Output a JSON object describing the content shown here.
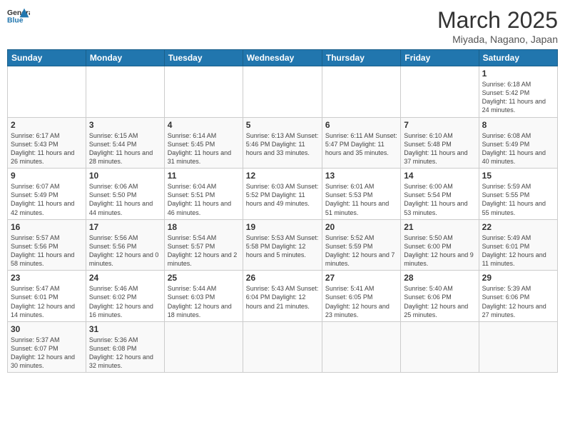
{
  "logo": {
    "line1": "General",
    "line2": "Blue"
  },
  "title": "March 2025",
  "subtitle": "Miyada, Nagano, Japan",
  "days_of_week": [
    "Sunday",
    "Monday",
    "Tuesday",
    "Wednesday",
    "Thursday",
    "Friday",
    "Saturday"
  ],
  "weeks": [
    [
      {
        "day": "",
        "info": ""
      },
      {
        "day": "",
        "info": ""
      },
      {
        "day": "",
        "info": ""
      },
      {
        "day": "",
        "info": ""
      },
      {
        "day": "",
        "info": ""
      },
      {
        "day": "",
        "info": ""
      },
      {
        "day": "1",
        "info": "Sunrise: 6:18 AM\nSunset: 5:42 PM\nDaylight: 11 hours and 24 minutes."
      }
    ],
    [
      {
        "day": "2",
        "info": "Sunrise: 6:17 AM\nSunset: 5:43 PM\nDaylight: 11 hours and 26 minutes."
      },
      {
        "day": "3",
        "info": "Sunrise: 6:15 AM\nSunset: 5:44 PM\nDaylight: 11 hours and 28 minutes."
      },
      {
        "day": "4",
        "info": "Sunrise: 6:14 AM\nSunset: 5:45 PM\nDaylight: 11 hours and 31 minutes."
      },
      {
        "day": "5",
        "info": "Sunrise: 6:13 AM\nSunset: 5:46 PM\nDaylight: 11 hours and 33 minutes."
      },
      {
        "day": "6",
        "info": "Sunrise: 6:11 AM\nSunset: 5:47 PM\nDaylight: 11 hours and 35 minutes."
      },
      {
        "day": "7",
        "info": "Sunrise: 6:10 AM\nSunset: 5:48 PM\nDaylight: 11 hours and 37 minutes."
      },
      {
        "day": "8",
        "info": "Sunrise: 6:08 AM\nSunset: 5:49 PM\nDaylight: 11 hours and 40 minutes."
      }
    ],
    [
      {
        "day": "9",
        "info": "Sunrise: 6:07 AM\nSunset: 5:49 PM\nDaylight: 11 hours and 42 minutes."
      },
      {
        "day": "10",
        "info": "Sunrise: 6:06 AM\nSunset: 5:50 PM\nDaylight: 11 hours and 44 minutes."
      },
      {
        "day": "11",
        "info": "Sunrise: 6:04 AM\nSunset: 5:51 PM\nDaylight: 11 hours and 46 minutes."
      },
      {
        "day": "12",
        "info": "Sunrise: 6:03 AM\nSunset: 5:52 PM\nDaylight: 11 hours and 49 minutes."
      },
      {
        "day": "13",
        "info": "Sunrise: 6:01 AM\nSunset: 5:53 PM\nDaylight: 11 hours and 51 minutes."
      },
      {
        "day": "14",
        "info": "Sunrise: 6:00 AM\nSunset: 5:54 PM\nDaylight: 11 hours and 53 minutes."
      },
      {
        "day": "15",
        "info": "Sunrise: 5:59 AM\nSunset: 5:55 PM\nDaylight: 11 hours and 55 minutes."
      }
    ],
    [
      {
        "day": "16",
        "info": "Sunrise: 5:57 AM\nSunset: 5:56 PM\nDaylight: 11 hours and 58 minutes."
      },
      {
        "day": "17",
        "info": "Sunrise: 5:56 AM\nSunset: 5:56 PM\nDaylight: 12 hours and 0 minutes."
      },
      {
        "day": "18",
        "info": "Sunrise: 5:54 AM\nSunset: 5:57 PM\nDaylight: 12 hours and 2 minutes."
      },
      {
        "day": "19",
        "info": "Sunrise: 5:53 AM\nSunset: 5:58 PM\nDaylight: 12 hours and 5 minutes."
      },
      {
        "day": "20",
        "info": "Sunrise: 5:52 AM\nSunset: 5:59 PM\nDaylight: 12 hours and 7 minutes."
      },
      {
        "day": "21",
        "info": "Sunrise: 5:50 AM\nSunset: 6:00 PM\nDaylight: 12 hours and 9 minutes."
      },
      {
        "day": "22",
        "info": "Sunrise: 5:49 AM\nSunset: 6:01 PM\nDaylight: 12 hours and 11 minutes."
      }
    ],
    [
      {
        "day": "23",
        "info": "Sunrise: 5:47 AM\nSunset: 6:01 PM\nDaylight: 12 hours and 14 minutes."
      },
      {
        "day": "24",
        "info": "Sunrise: 5:46 AM\nSunset: 6:02 PM\nDaylight: 12 hours and 16 minutes."
      },
      {
        "day": "25",
        "info": "Sunrise: 5:44 AM\nSunset: 6:03 PM\nDaylight: 12 hours and 18 minutes."
      },
      {
        "day": "26",
        "info": "Sunrise: 5:43 AM\nSunset: 6:04 PM\nDaylight: 12 hours and 21 minutes."
      },
      {
        "day": "27",
        "info": "Sunrise: 5:41 AM\nSunset: 6:05 PM\nDaylight: 12 hours and 23 minutes."
      },
      {
        "day": "28",
        "info": "Sunrise: 5:40 AM\nSunset: 6:06 PM\nDaylight: 12 hours and 25 minutes."
      },
      {
        "day": "29",
        "info": "Sunrise: 5:39 AM\nSunset: 6:06 PM\nDaylight: 12 hours and 27 minutes."
      }
    ],
    [
      {
        "day": "30",
        "info": "Sunrise: 5:37 AM\nSunset: 6:07 PM\nDaylight: 12 hours and 30 minutes."
      },
      {
        "day": "31",
        "info": "Sunrise: 5:36 AM\nSunset: 6:08 PM\nDaylight: 12 hours and 32 minutes."
      },
      {
        "day": "",
        "info": ""
      },
      {
        "day": "",
        "info": ""
      },
      {
        "day": "",
        "info": ""
      },
      {
        "day": "",
        "info": ""
      },
      {
        "day": "",
        "info": ""
      }
    ]
  ]
}
